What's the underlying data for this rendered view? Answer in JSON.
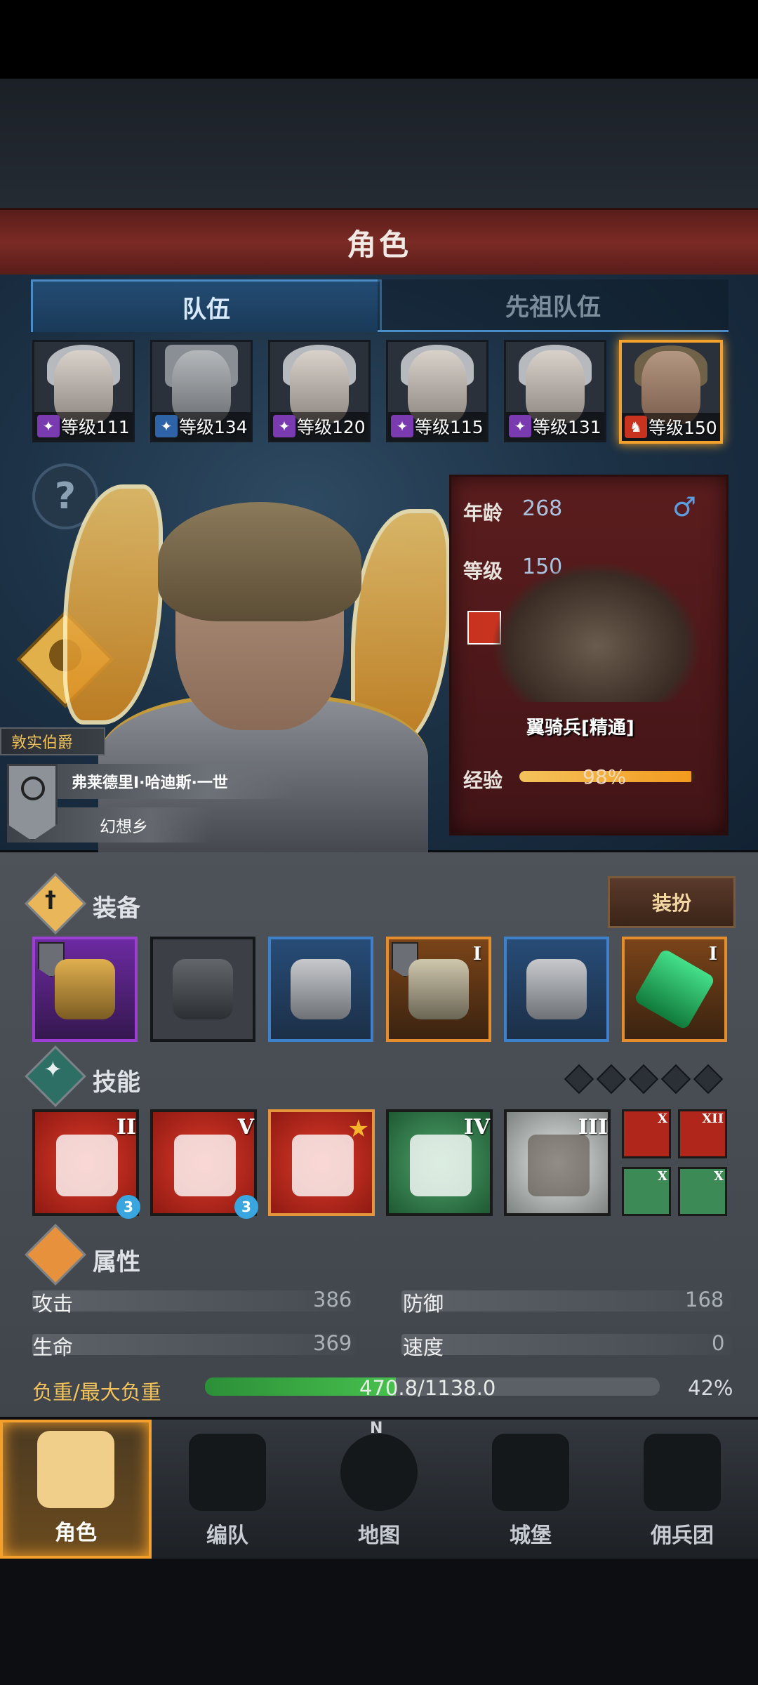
{
  "header": {
    "title": "角色"
  },
  "tabs": [
    {
      "label": "队伍",
      "active": true
    },
    {
      "label": "先祖队伍",
      "active": false
    }
  ],
  "team": [
    {
      "level_text": "等级111",
      "selected": false
    },
    {
      "level_text": "等级134",
      "selected": false
    },
    {
      "level_text": "等级120",
      "selected": false
    },
    {
      "level_text": "等级115",
      "selected": false
    },
    {
      "level_text": "等级131",
      "selected": false
    },
    {
      "level_text": "等级150",
      "selected": true
    }
  ],
  "help_icon": "?",
  "character": {
    "title": "敦实伯爵",
    "name": "弗莱德里Ⅰ·哈迪斯·一世",
    "region": "幻想乡"
  },
  "info": {
    "age_label": "年龄",
    "age": "268",
    "gender_icon": "♂",
    "level_label": "等级",
    "level": "150",
    "unit_name": "翼骑兵[精通]",
    "exp_label": "经验",
    "exp_text": "98%",
    "exp_fraction": 0.98
  },
  "equipment": {
    "title": "装备",
    "dress_button": "装扮",
    "slots": [
      {
        "rarity": "purple",
        "roman": "",
        "flag": true
      },
      {
        "rarity": "gray",
        "roman": "",
        "flag": false
      },
      {
        "rarity": "blue",
        "roman": "",
        "flag": false
      },
      {
        "rarity": "orange",
        "roman": "I",
        "flag": true
      },
      {
        "rarity": "blue",
        "roman": "",
        "flag": false
      },
      {
        "rarity": "orange",
        "roman": "I",
        "flag": false
      }
    ]
  },
  "skills": {
    "title": "技能",
    "skills": [
      {
        "color": "red",
        "roman": "II",
        "badge": "3"
      },
      {
        "color": "red",
        "roman": "V",
        "badge": "3"
      },
      {
        "color": "red",
        "roman": "",
        "badge": "",
        "star": true
      },
      {
        "color": "green",
        "roman": "IV",
        "badge": ""
      },
      {
        "color": "white",
        "roman": "III",
        "badge": ""
      }
    ],
    "mini": [
      {
        "color": "red",
        "roman": "X"
      },
      {
        "color": "red",
        "roman": "XII"
      },
      {
        "color": "green",
        "roman": "X"
      },
      {
        "color": "green",
        "roman": "X"
      }
    ]
  },
  "attributes": {
    "title": "属性",
    "attack_label": "攻击",
    "attack": "386",
    "defense_label": "防御",
    "defense": "168",
    "hp_label": "生命",
    "hp": "369",
    "speed_label": "速度",
    "speed": "0",
    "load_label": "负重/最大负重",
    "load_text": "470.8/1138.0",
    "load_pct": "42%",
    "load_fraction": 0.42
  },
  "nav": [
    {
      "label": "角色",
      "active": true
    },
    {
      "label": "编队",
      "active": false
    },
    {
      "label": "地图",
      "active": false
    },
    {
      "label": "城堡",
      "active": false
    },
    {
      "label": "佣兵团",
      "active": false
    }
  ],
  "compass_n": "N"
}
